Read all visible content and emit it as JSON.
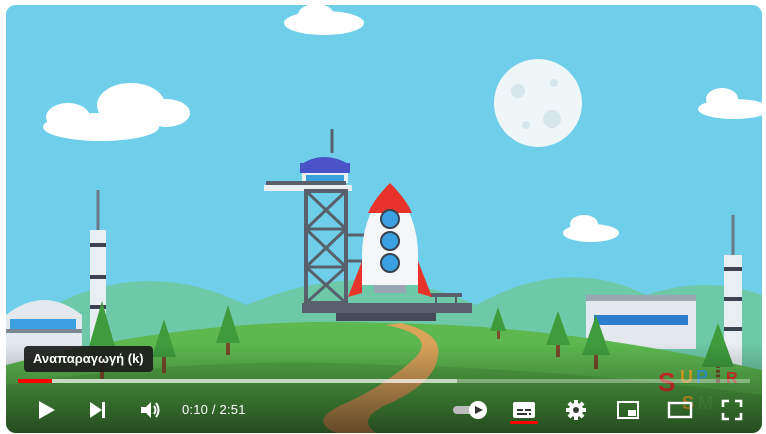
{
  "player": {
    "tooltip": "Αναπαραγωγή (k)",
    "progress": {
      "played_fraction": 0.046,
      "loaded_fraction": 0.6
    },
    "time": {
      "current": "0:10",
      "separator": " / ",
      "duration": "2:51"
    },
    "subtitles_on": true,
    "colors": {
      "accent": "#ff0000",
      "sky": "#6fcfea",
      "hill": "#5db84f",
      "path": "#d9a35a"
    }
  },
  "channel_watermark": {
    "text": "SUPER SIMPLE",
    "colors": [
      "#e8332b",
      "#f7b529",
      "#3aa9e0",
      "#5db84f"
    ]
  },
  "icons": {
    "play": "play-icon",
    "next": "next-icon",
    "volume": "volume-icon",
    "autoplay": "autoplay-toggle-icon",
    "subtitles": "subtitles-icon",
    "settings": "settings-icon",
    "miniplayer": "miniplayer-icon",
    "theater": "theater-mode-icon",
    "fullscreen": "fullscreen-icon"
  }
}
